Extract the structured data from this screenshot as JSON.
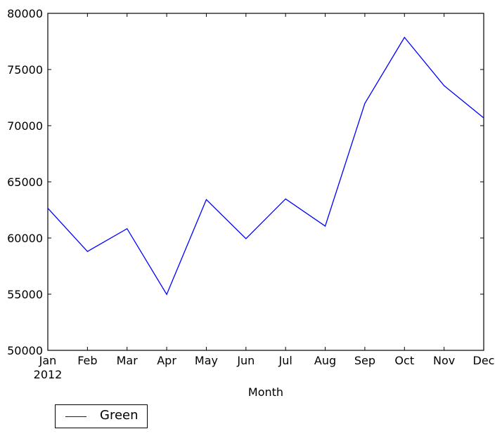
{
  "chart_data": {
    "type": "line",
    "title": "",
    "xlabel": "Month",
    "ylabel": "",
    "categories": [
      "Jan",
      "Feb",
      "Mar",
      "Apr",
      "May",
      "Jun",
      "Jul",
      "Aug",
      "Sep",
      "Oct",
      "Nov",
      "Dec"
    ],
    "x_sublabel": "2012",
    "ylim": [
      50000,
      80000
    ],
    "yticks": [
      50000,
      55000,
      60000,
      65000,
      70000,
      75000,
      80000
    ],
    "ytick_labels": [
      "50000",
      "55000",
      "60000",
      "65000",
      "70000",
      "75000",
      "80000"
    ],
    "series": [
      {
        "name": "Green",
        "color": "#0000ff",
        "values": [
          62650,
          58800,
          60830,
          54980,
          63420,
          59940,
          63480,
          61060,
          71980,
          77860,
          73560,
          70690
        ]
      }
    ],
    "legend": {
      "position": "below-left",
      "entries": [
        "Green"
      ]
    },
    "grid": false
  }
}
